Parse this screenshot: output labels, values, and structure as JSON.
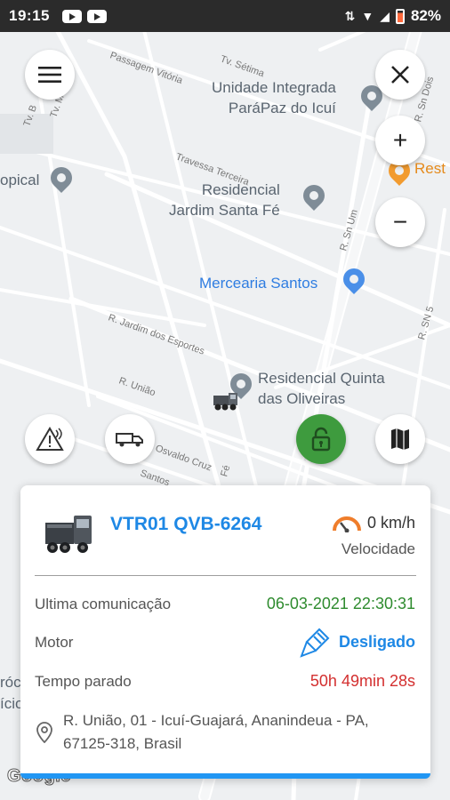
{
  "status_bar": {
    "time": "19:15",
    "battery": "82%"
  },
  "map": {
    "streets": [
      "Tv. Sétima",
      "Passagem Vitória",
      "Tv. B",
      "Tv. M",
      "Travessa Terceira",
      "R. Sn Um",
      "R. Sn Dois",
      "R. Jardim dos Esportes",
      "R. União",
      "R. SN 5",
      "Osvaldo Cruz",
      "Santos",
      "Fé"
    ],
    "pois": [
      {
        "name": "Unidade Integrada\nParáPaz do Icuí",
        "color": "gray"
      },
      {
        "name": "Residencial\nJardim Santa Fé",
        "color": "gray"
      },
      {
        "name": "Mercearia Santos",
        "color": "blue"
      },
      {
        "name": "Residencial Quinta\ndas Oliveiras",
        "color": "gray"
      },
      {
        "name": "Rest",
        "color": "orange"
      },
      {
        "name": "opical",
        "color": "gray"
      }
    ],
    "left_fragments": [
      "rócr",
      "ício"
    ],
    "google_logo": "Google"
  },
  "controls": {
    "menu": "menu-icon",
    "close": "close-icon",
    "zoom_in": "+",
    "zoom_out": "−"
  },
  "card": {
    "vehicle": "VTR01 QVB-6264",
    "speed_value": "0 km/h",
    "speed_label": "Velocidade",
    "rows": [
      {
        "label": "Ultima comunicação",
        "value": "06-03-2021 22:30:31"
      },
      {
        "label": "Motor",
        "value": "Desligado"
      },
      {
        "label": "Tempo parado",
        "value": "50h 49min 28s"
      }
    ],
    "address": "R. União, 01 - Icuí-Guajará, Ananindeua - PA, 67125-318, Brasil"
  },
  "colors": {
    "accent": "#1e88e5",
    "green": "#2e8b2e",
    "red": "#d32f2f",
    "lock_button": "#3e9b3e"
  }
}
